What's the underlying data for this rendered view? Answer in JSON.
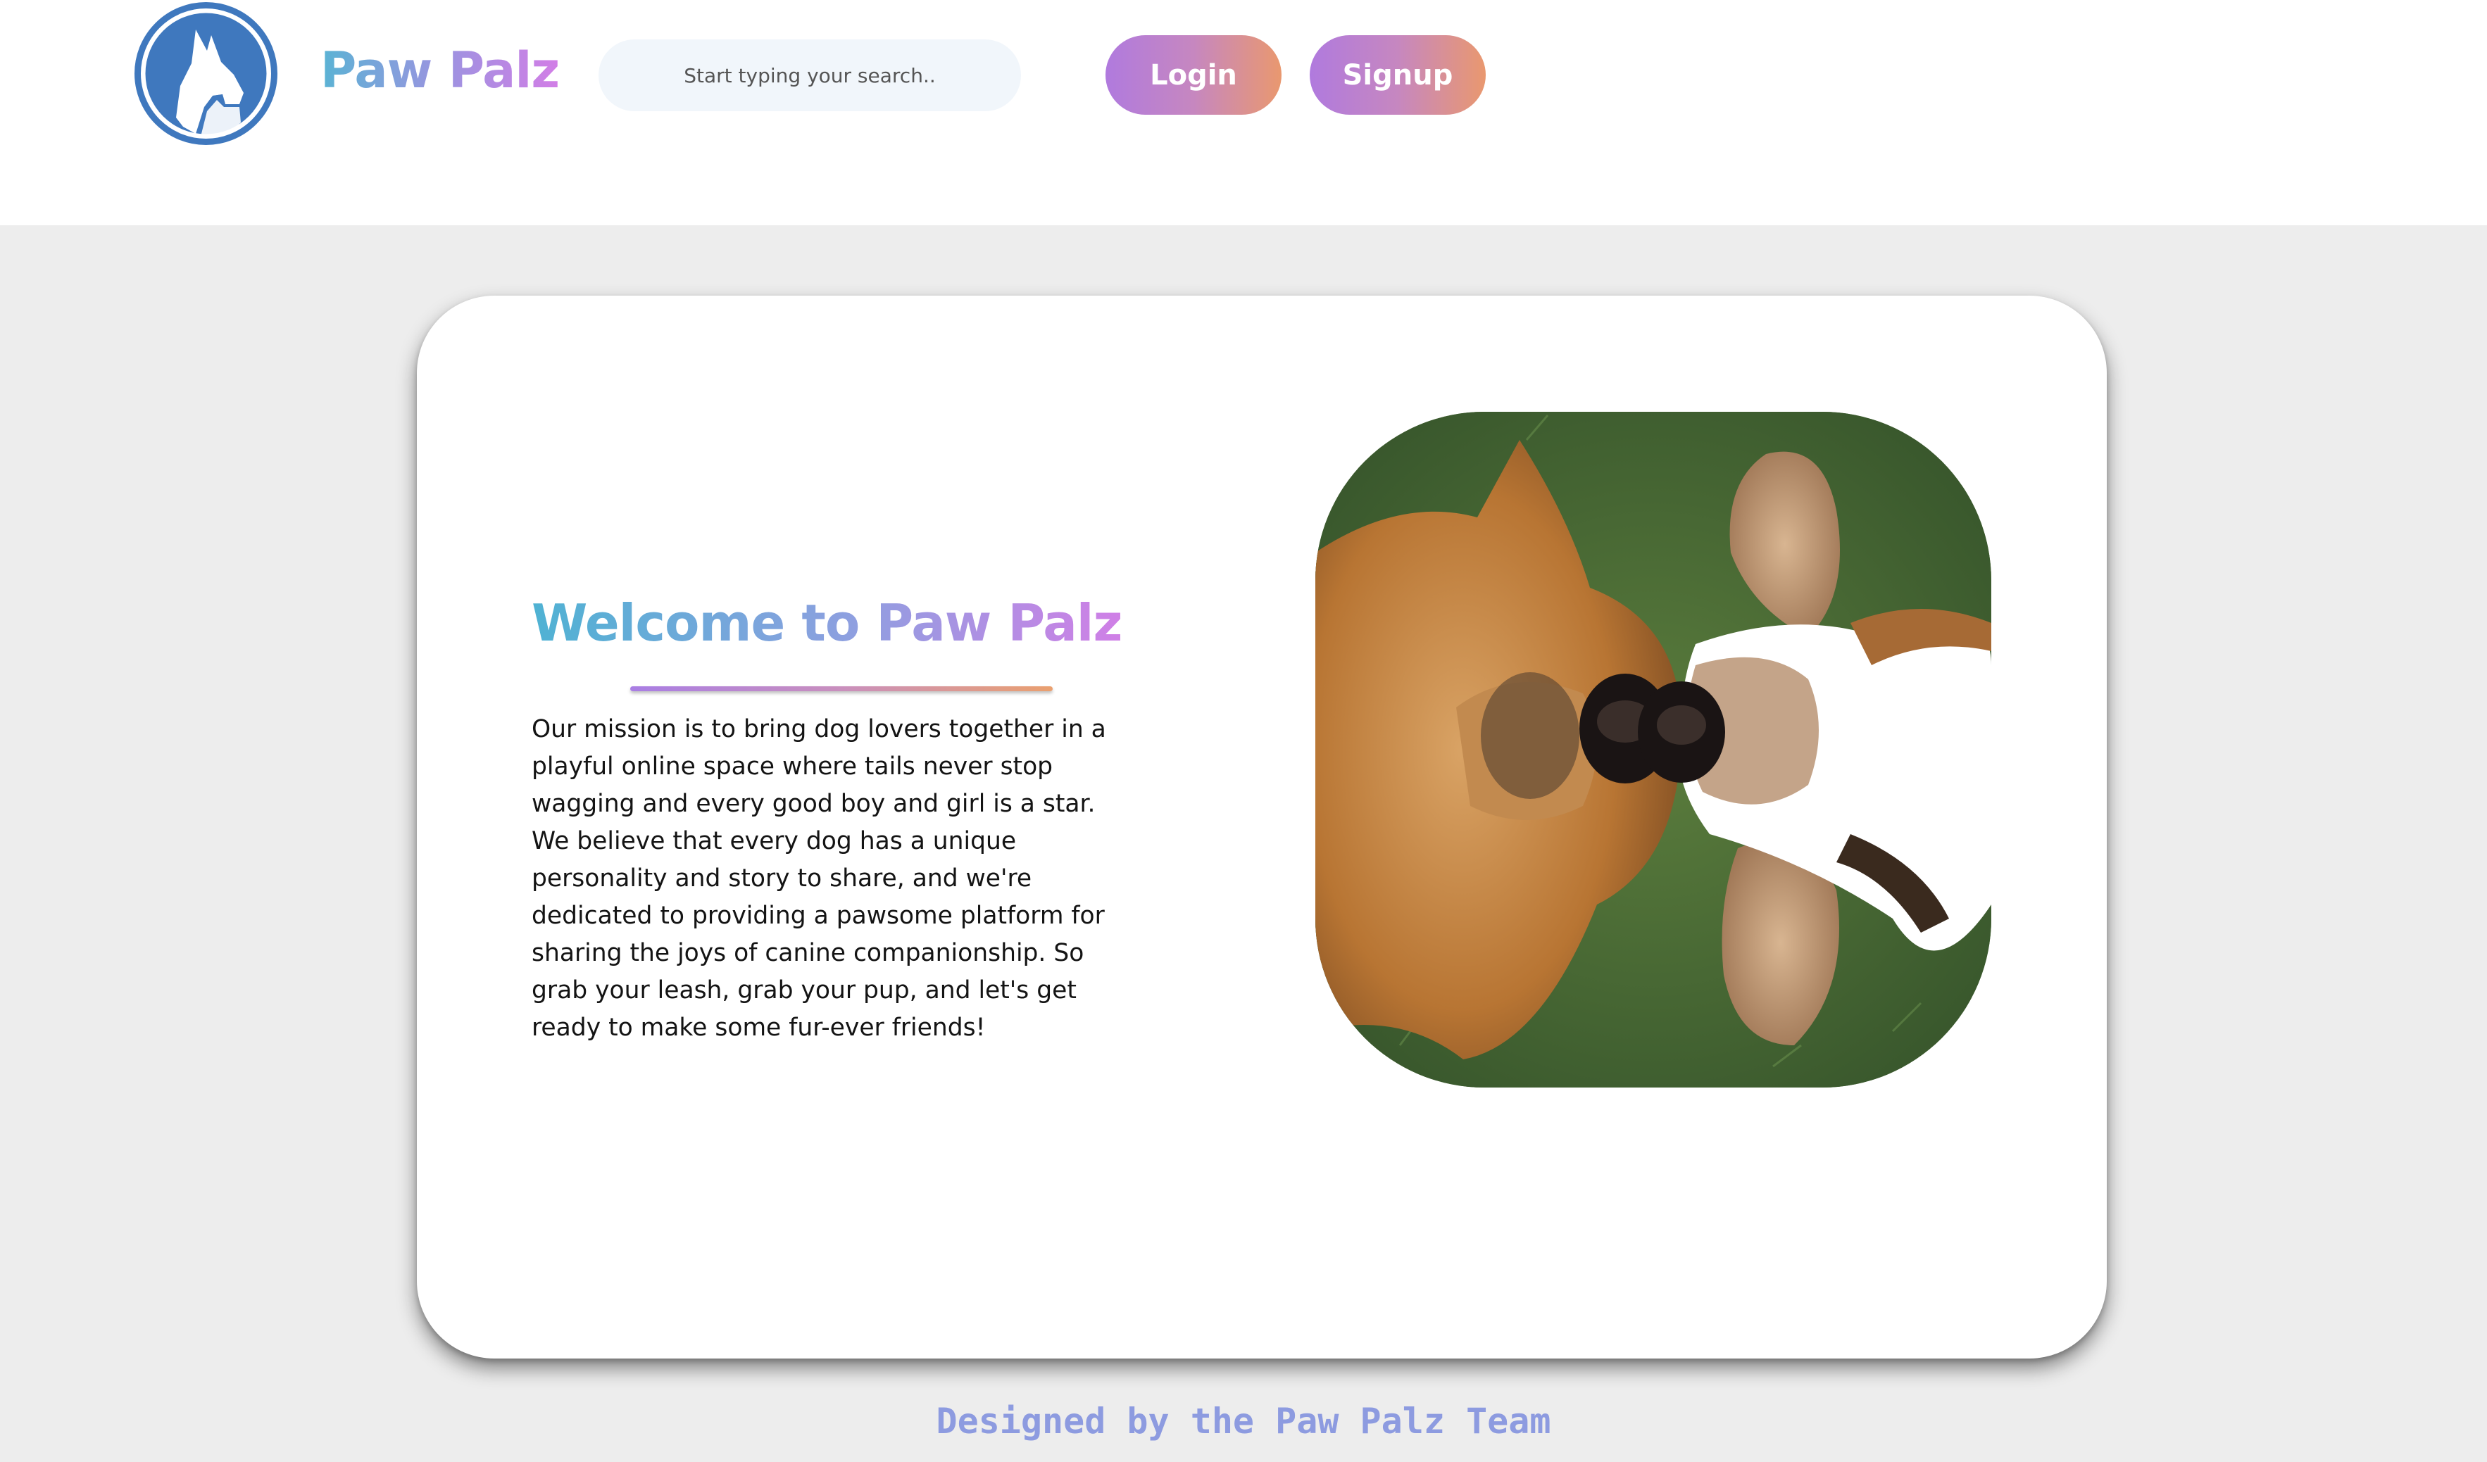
{
  "header": {
    "brand": "Paw Palz",
    "search": {
      "placeholder": "Start typing your search..",
      "value": ""
    },
    "login_label": "Login",
    "signup_label": "Signup"
  },
  "main": {
    "title": "Welcome to Paw Palz",
    "mission": "Our mission is to bring dog lovers together in a playful online space where tails never stop wagging and every good boy and girl is a star. We believe that every dog has a unique personality and story to share, and we're dedicated to providing a pawsome platform for sharing the joys of canine companionship. So grab your leash, grab your pup, and let's get ready to make some fur-ever friends!",
    "image": "two-dogs-lying-on-grass-photo"
  },
  "footer": {
    "credit": "Designed by the Paw Palz Team"
  },
  "colors": {
    "accent_gradient_start": "#b07ade",
    "accent_gradient_end": "#e9986f",
    "brand_blue": "#5ab3d4",
    "brand_purple": "#d27ee6",
    "logo_blue": "#3f78be",
    "page_background": "#ededed"
  },
  "icons": {
    "logo": "dog-head-logo-icon"
  }
}
